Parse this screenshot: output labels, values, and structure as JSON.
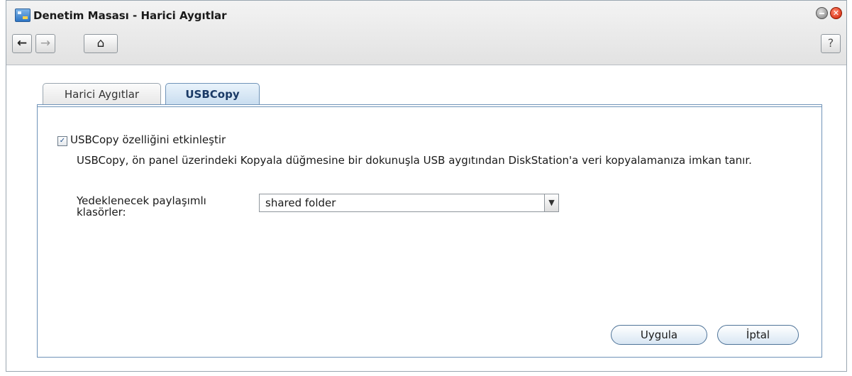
{
  "window": {
    "title": "Denetim Masası - Harici Aygıtlar",
    "icon": "control-panel-icon"
  },
  "toolbar": {
    "back_icon": "←",
    "forward_icon": "→",
    "home_icon": "⌂",
    "help_label": "?"
  },
  "tabs": [
    {
      "label": "Harici Aygıtlar",
      "active": false
    },
    {
      "label": "USBCopy",
      "active": true
    }
  ],
  "usbcopy": {
    "enable_checked": true,
    "enable_label": "USBCopy özelliğini etkinleştir",
    "description": "USBCopy, ön panel üzerindeki Kopyala düğmesine bir dokunuşla USB aygıtından DiskStation'a veri kopyalamanıza imkan tanır.",
    "folder_label": "Yedeklenecek paylaşımlı klasörler:",
    "folder_value": "shared folder"
  },
  "buttons": {
    "apply": "Uygula",
    "cancel": "İptal"
  },
  "colors": {
    "accent": "#6f93b8",
    "close": "#d21c00"
  }
}
